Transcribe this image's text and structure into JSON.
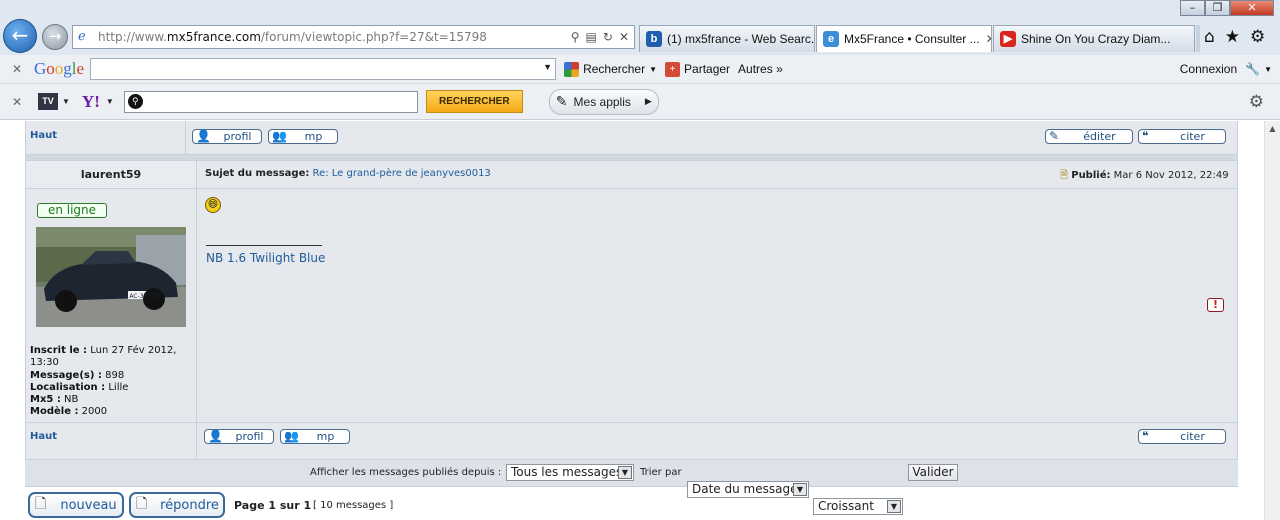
{
  "browser": {
    "url_prefix": "http://www.",
    "url_domain": "mx5france.com",
    "url_rest": "/forum/viewtopic.php?f=27&t=15798",
    "tabs": [
      {
        "label": "(1) mx5france - Web Searc...",
        "icon": "bing-icon",
        "color": "#1f5fae"
      },
      {
        "label": "Mx5France • Consulter ...",
        "icon": "ie-icon",
        "color": "#3a8fd8"
      },
      {
        "label": "Shine On You Crazy Diam...",
        "icon": "youtube-icon",
        "color": "#d9261c"
      }
    ]
  },
  "google_toolbar": {
    "logo": "Google",
    "search_label": "Rechercher",
    "share_label": "Partager",
    "more_label": "Autres »",
    "connexion_label": "Connexion"
  },
  "yahoo_toolbar": {
    "search_button": "RECHERCHER",
    "apps_label": "Mes applis",
    "logo_text": "Y!",
    "tv_text": "TV"
  },
  "post_prev": {
    "haut_label": "Haut",
    "profil_label": "profil",
    "mp_label": "mp",
    "edit_label": "éditer",
    "quote_label": "citer"
  },
  "post": {
    "author": "laurent59",
    "subject_label": "Sujet du message:",
    "subject": "Re: Le grand-père de jeanyves0013",
    "published_label": "Publié:",
    "published_date": "Mar 6 Nov 2012, 22:49",
    "online_label": "en ligne",
    "signature": "NB 1.6 Twilight Blue",
    "plate": "AC-357-TV",
    "info": [
      {
        "label": "Inscrit le :",
        "value": "Lun 27 Fév 2012, 13:30"
      },
      {
        "label": "Message(s) :",
        "value": "898"
      },
      {
        "label": "Localisation :",
        "value": "Lille"
      },
      {
        "label": "Mx5 :",
        "value": "NB"
      },
      {
        "label": "Modèle :",
        "value": "2000"
      }
    ],
    "haut_label": "Haut",
    "profil_label": "profil",
    "mp_label": "mp",
    "quote_label": "citer"
  },
  "sort_bar": {
    "display_label": "Afficher les messages publiés depuis :",
    "display_value": "Tous les messages",
    "sort_label": "Trier par",
    "sort_value": "Date du message",
    "order_value": "Croissant",
    "submit_label": "Valider"
  },
  "footer": {
    "new_label": "nouveau",
    "reply_label": "répondre",
    "page_text": "Page 1 sur 1",
    "count_text": "[ 10 messages ]"
  }
}
